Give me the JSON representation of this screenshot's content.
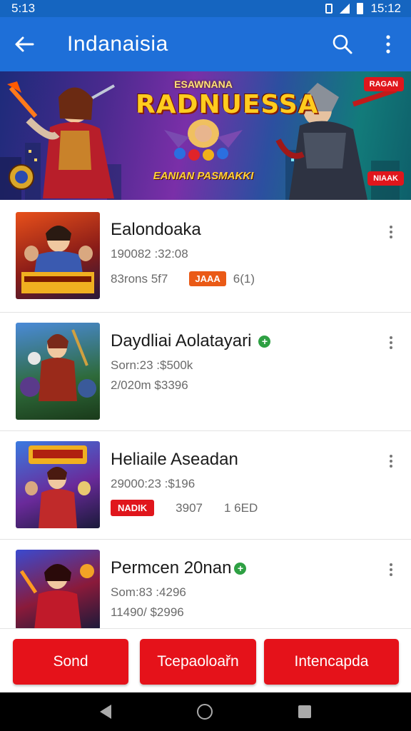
{
  "status_bar": {
    "time_left": "5:13",
    "time_right": "15:12"
  },
  "app_bar": {
    "title": "Indanaisia"
  },
  "banner": {
    "logo_top": "ESAWNANA",
    "logo_main": "RADNUESSA",
    "logo_sub": "EANIAN PASMAKKI",
    "tag_top": "RAGAN",
    "tag_bottom": "NIAAK"
  },
  "items": [
    {
      "name": "Ealondoaka",
      "line1": "190082 :32:08",
      "line2a": "83rons  5f7",
      "badge": "JAAA",
      "line2b": "6(1)",
      "verified": false
    },
    {
      "name": "Daydliai Aolatayari",
      "line1": "Sorn:23 :$500k",
      "line2a": "2/020m   $3396",
      "verified": true
    },
    {
      "name": "Heliaile Aseadan",
      "line1": "29000:23 :$196",
      "badge": "NADIK",
      "line2a": "3907",
      "line2b": "1 6ED",
      "verified": false
    },
    {
      "name": "Permcen 20nan",
      "line1": "Som:83 :4296",
      "line2a": "11490/  $2996",
      "verified": true
    }
  ],
  "actions": {
    "btn1": "Sond",
    "btn2": "Tcepaoloařn",
    "btn3": "Intencapda"
  },
  "colors": {
    "primary": "#1e6fd8",
    "accent": "#e5121a",
    "badge_orange": "#ea5a16",
    "verified_green": "#2ea043"
  }
}
